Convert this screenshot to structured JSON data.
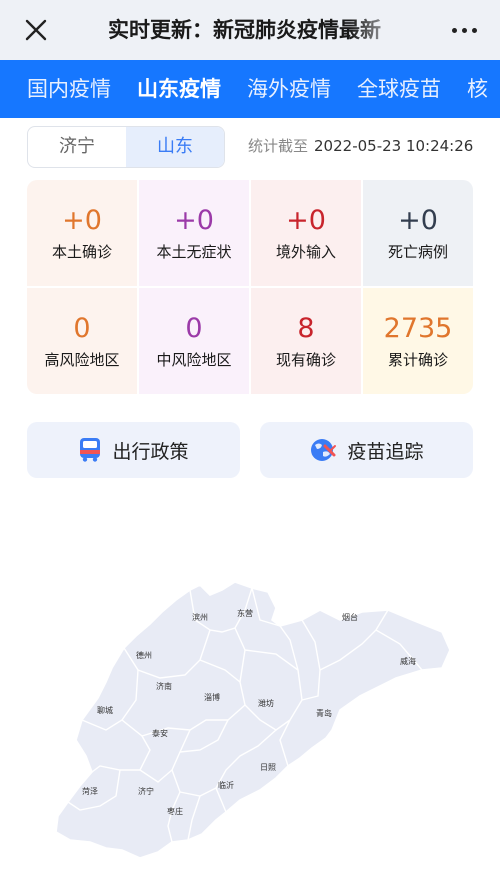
{
  "header": {
    "title": "实时更新：新冠肺炎疫情最新"
  },
  "nav": {
    "tabs": [
      "国内疫情",
      "山东疫情",
      "海外疫情",
      "全球疫苗",
      "核"
    ]
  },
  "region": {
    "options": [
      "济宁",
      "山东"
    ],
    "selected": "山东"
  },
  "stats_time": {
    "label": "统计截至",
    "value": "2022-05-23 10:24:26"
  },
  "stats": [
    {
      "value": "+0",
      "label": "本土确诊",
      "color": "#e0762d",
      "bg": "#fdf3ee"
    },
    {
      "value": "+0",
      "label": "本土无症状",
      "color": "#9b3aa8",
      "bg": "#faf1fb"
    },
    {
      "value": "+0",
      "label": "境外输入",
      "color": "#c8242c",
      "bg": "#fcefef"
    },
    {
      "value": "+0",
      "label": "死亡病例",
      "color": "#333e4f",
      "bg": "#eef1f5"
    },
    {
      "value": "0",
      "label": "高风险地区",
      "color": "#e0762d",
      "bg": "#fdf3ee"
    },
    {
      "value": "0",
      "label": "中风险地区",
      "color": "#9b3aa8",
      "bg": "#faf1fb"
    },
    {
      "value": "8",
      "label": "现有确诊",
      "color": "#c8242c",
      "bg": "#fcefef"
    },
    {
      "value": "2735",
      "label": "累计确诊",
      "color": "#e0762d",
      "bg": "#fff8e6"
    }
  ],
  "actions": {
    "travel_label": "出行政策",
    "vaccine_label": "疫苗追踪"
  },
  "map": {
    "cities": [
      "滨州",
      "东营",
      "烟台",
      "德州",
      "威海",
      "济南",
      "淄博",
      "潍坊",
      "聊城",
      "青岛",
      "泰安",
      "日照",
      "菏泽",
      "济宁",
      "临沂",
      "枣庄"
    ]
  },
  "colors": {
    "accent": "#1677ff",
    "map_fill": "#e8ebf5",
    "map_border": "#ffffff"
  }
}
